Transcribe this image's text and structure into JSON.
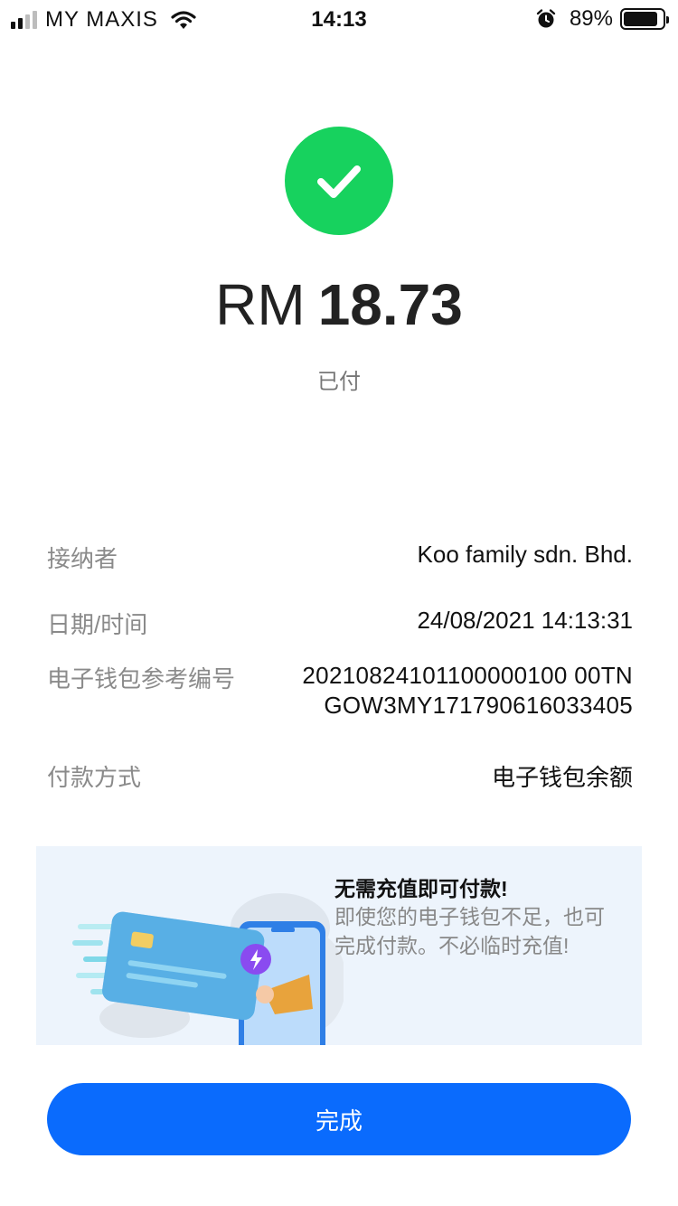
{
  "status_bar": {
    "carrier": "MY MAXIS",
    "time": "14:13",
    "battery_pct": "89%",
    "battery_level": 0.89,
    "signal_bars": 2,
    "icons": [
      "signal-icon",
      "wifi-icon",
      "alarm-icon",
      "battery-icon"
    ]
  },
  "result": {
    "icon": "check-circle-icon",
    "currency": "RM",
    "amount": "18.73",
    "status": "已付"
  },
  "details": [
    {
      "label": "接纳者",
      "value": "Koo family sdn. Bhd."
    },
    {
      "label": "日期/时间",
      "value": "24/08/2021 14:13:31"
    },
    {
      "label": "电子钱包参考编号",
      "value_lines": [
        "20210824101100000100 00TN",
        "GOW3MY171790616033405"
      ]
    },
    {
      "label": "付款方式",
      "value": "电子钱包余额"
    }
  ],
  "promo": {
    "title": "无需充值即可付款!",
    "description": "即使您的电子钱包不足，也可完成付款。不必临时充值!"
  },
  "done_button": {
    "label": "完成"
  },
  "colors": {
    "success": "#17d25e",
    "primary": "#0a6bfd",
    "promo_bg": "#edf4fc"
  }
}
